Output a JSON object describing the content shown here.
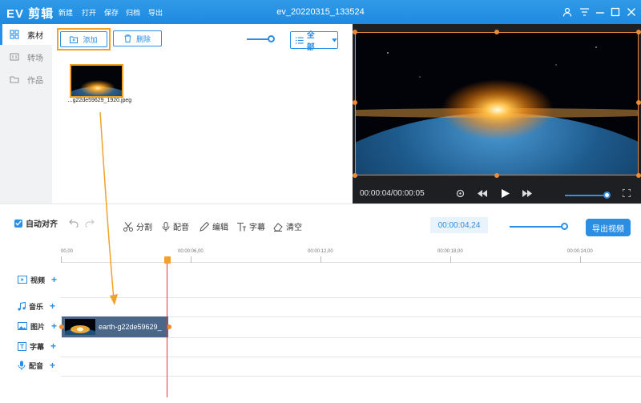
{
  "app": {
    "logo": "EV 剪辑",
    "title": "ev_20220315_133524",
    "menu": [
      "新建",
      "打开",
      "保存",
      "归档",
      "导出"
    ]
  },
  "sidebar": {
    "items": [
      {
        "label": "素材",
        "icon": "grid-icon",
        "active": true
      },
      {
        "label": "转场",
        "icon": "transition-icon",
        "active": false
      },
      {
        "label": "作品",
        "icon": "folder-icon",
        "active": false
      }
    ]
  },
  "materials": {
    "add_label": "添加",
    "delete_label": "删除",
    "filter_value": "全部",
    "items": [
      {
        "name": "...g22de59629_1920.jpeg"
      }
    ]
  },
  "preview": {
    "time": "00:00:04/00:00:05"
  },
  "toolbar": {
    "auto_align": "自动对齐",
    "split": "分割",
    "dub": "配音",
    "edit": "编辑",
    "subtitle": "字幕",
    "clear": "清空",
    "timecode": "00:00:04,24",
    "export": "导出视频"
  },
  "timeline": {
    "ruler": [
      "00,00",
      "00:00:06,00",
      "00:00:12,00",
      "00:00:18,00",
      "00:00:24,00"
    ],
    "tracks": [
      "视频",
      "音乐",
      "图片",
      "字幕",
      "配音"
    ],
    "clip_label": "earth-g22de59629_"
  },
  "colors": {
    "accent": "#2a8ee4",
    "highlight": "#f0a22a",
    "playhead": "#e23a3a",
    "clip": "#4a6689"
  }
}
